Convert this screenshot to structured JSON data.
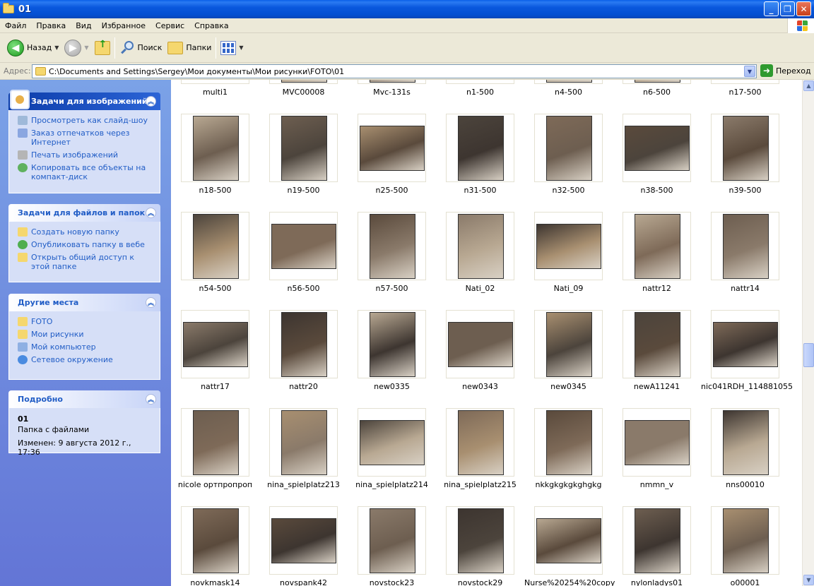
{
  "window": {
    "title": "01"
  },
  "menu": [
    "Файл",
    "Правка",
    "Вид",
    "Избранное",
    "Сервис",
    "Справка"
  ],
  "toolbar": {
    "back": "Назад",
    "search": "Поиск",
    "folders": "Папки"
  },
  "address": {
    "label": "Адрес:",
    "path": "C:\\Documents and Settings\\Sergey\\Мои документы\\Мои рисунки\\FOTO\\01",
    "go": "Переход"
  },
  "sidebar": {
    "image_tasks": {
      "title": "Задачи для изображений",
      "items": [
        "Просмотреть как слайд-шоу",
        "Заказ отпечатков через Интернет",
        "Печать изображений",
        "Копировать все объекты на компакт-диск"
      ]
    },
    "file_tasks": {
      "title": "Задачи для файлов и папок",
      "items": [
        "Создать новую папку",
        "Опубликовать папку в вебе",
        "Открыть общий доступ к этой папке"
      ]
    },
    "other_places": {
      "title": "Другие места",
      "items": [
        "FOTO",
        "Мои рисунки",
        "Мой компьютер",
        "Сетевое окружение"
      ]
    },
    "details": {
      "title": "Подробно",
      "name": "01",
      "type": "Папка с файлами",
      "modified": "Изменен: 9 августа 2012 г., 17:36"
    }
  },
  "files": {
    "row0": [
      "multi1",
      "MVC00008",
      "Mvc-131s",
      "n1-500",
      "n4-500",
      "n6-500",
      "n17-500"
    ],
    "row1": [
      "n18-500",
      "n19-500",
      "n25-500",
      "n31-500",
      "n32-500",
      "n38-500",
      "n39-500"
    ],
    "row2": [
      "n54-500",
      "n56-500",
      "n57-500",
      "Nati_02",
      "Nati_09",
      "nattr12",
      "nattr14"
    ],
    "row3": [
      "nattr17",
      "nattr20",
      "new0335",
      "new0343",
      "new0345",
      "newA11241",
      "nic041RDH_114881055"
    ],
    "row4": [
      "nicole ортпропроп",
      "nina_spielplatz213",
      "nina_spielplatz214",
      "nina_spielplatz215",
      "nkkgkgkgkghgkg",
      "nmmn_v",
      "nns00010"
    ],
    "row5": [
      "novkmask14",
      "novspank42",
      "novstock23",
      "novstock29",
      "Nurse%20254%20copy",
      "nylonladys01",
      "o00001"
    ]
  }
}
